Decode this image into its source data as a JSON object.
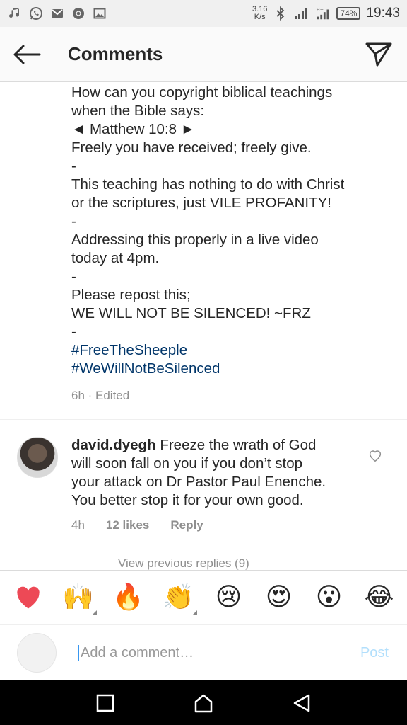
{
  "status_bar": {
    "speed_value": "3.16",
    "speed_unit": "K/s",
    "battery": "74%",
    "time": "19:43",
    "icons": [
      "music-note-icon",
      "whatsapp-icon",
      "gmail-icon",
      "chrome-icon",
      "image-icon",
      "bluetooth-icon",
      "signal-icon",
      "signal-h-icon"
    ]
  },
  "header": {
    "title": "Comments"
  },
  "caption": {
    "lines": [
      "How can you copyright biblical teachings",
      "when the Bible says:",
      "◄ Matthew 10:8 ►",
      "Freely you have received; freely give.",
      "-",
      "This teaching has nothing to do with Christ",
      "or the scriptures, just VILE PROFANITY!",
      "-",
      "Addressing this properly in a live video",
      "today at 4pm.",
      "-",
      "Please repost this;",
      "WE WILL NOT BE SILENCED! ~FRZ",
      "-"
    ],
    "hashtags": [
      "#FreeTheSheeple",
      "#WeWillNotBeSilenced"
    ],
    "meta": "6h · Edited"
  },
  "comment": {
    "username": "david.dyegh",
    "text_lines": [
      "Freeze the wrath of God",
      "will soon fall on you if you don’t stop",
      "your attack on Dr Pastor Paul Enenche.",
      "You better stop it for your own good."
    ],
    "time": "4h",
    "likes": "12 likes",
    "reply": "Reply"
  },
  "view_replies": "View previous replies (9)",
  "emoji_bar": [
    "❤",
    "🙌",
    "🔥",
    "👏",
    "😢",
    "😍",
    "😮",
    "😂"
  ],
  "composer": {
    "placeholder": "Add a comment…",
    "post_label": "Post"
  },
  "colors": {
    "hashtag": "#003569",
    "post_disabled": "#b2dffc",
    "meta_gray": "#8e8e8e",
    "heart": "#ed4956"
  }
}
